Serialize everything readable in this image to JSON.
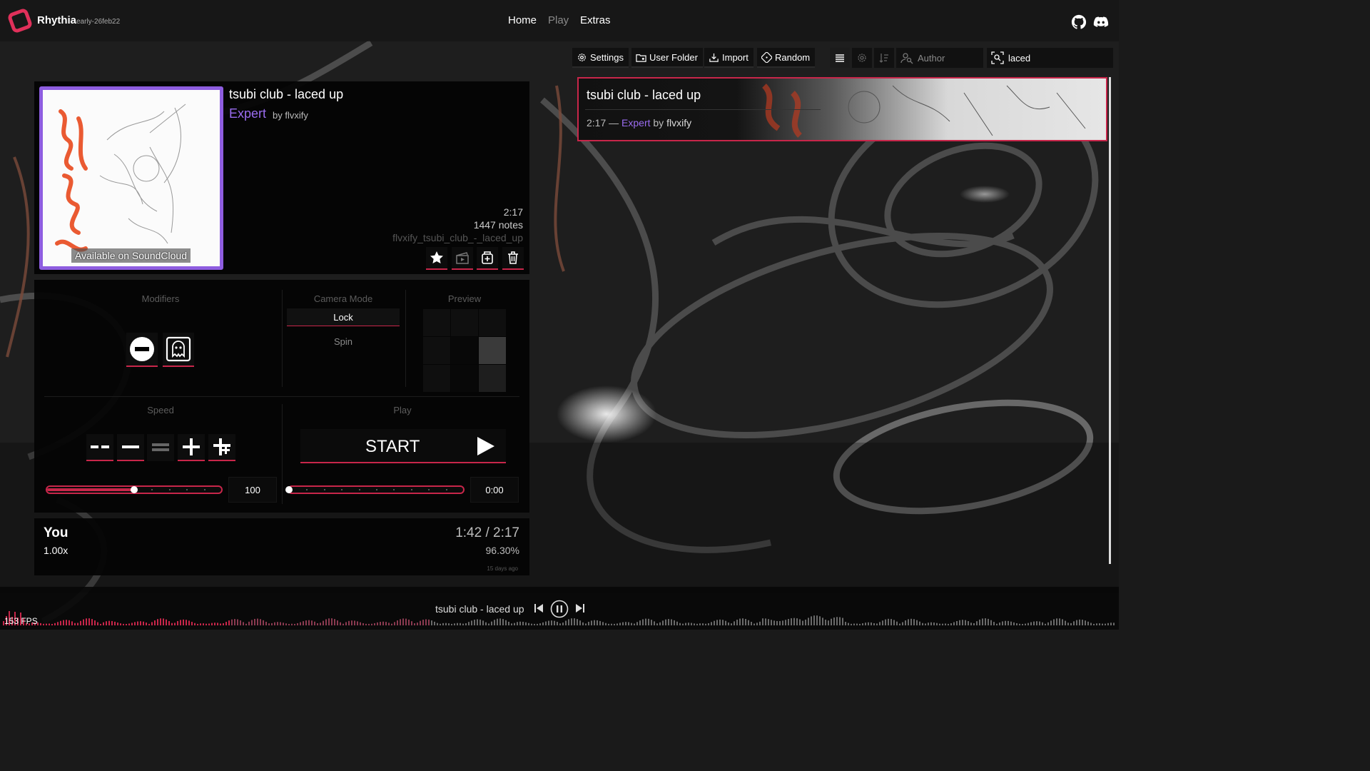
{
  "app": {
    "name": "Rhythia",
    "version": "early-26feb22",
    "accent_color": "#c8264a",
    "difficulty_color": "#9a6cf0"
  },
  "nav": {
    "items": [
      {
        "label": "Home",
        "active": true
      },
      {
        "label": "Play",
        "active": false
      },
      {
        "label": "Extras",
        "active": true
      }
    ],
    "right_icons": [
      "github-icon",
      "discord-icon"
    ]
  },
  "toolbar": {
    "settings_label": "Settings",
    "user_folder_label": "User Folder",
    "import_label": "Import",
    "random_label": "Random",
    "view_icons": [
      "list-view-icon",
      "filter-settings-icon",
      "sort-icon"
    ],
    "author_placeholder": "Author",
    "search_value": "laced"
  },
  "selected_map": {
    "title": "tsubi club - laced up",
    "difficulty": "Expert",
    "by_label": "by flvxify",
    "cover_badge": "Available on SoundCloud",
    "length": "2:17",
    "notes": "1447 notes",
    "map_id": "flvxify_tsubi_club_-_laced_up",
    "actions": [
      "favorite-star-icon",
      "video-icon",
      "copy-icon",
      "delete-icon"
    ]
  },
  "modifiers": {
    "label": "Modifiers",
    "buttons": [
      "no-fail-icon",
      "ghost-icon"
    ]
  },
  "camera": {
    "label": "Camera Mode",
    "options": [
      {
        "label": "Lock",
        "selected": true
      },
      {
        "label": "Spin",
        "selected": false
      }
    ]
  },
  "preview": {
    "label": "Preview"
  },
  "speed": {
    "label": "Speed",
    "buttons": [
      "speed-down-large-icon",
      "speed-down-icon",
      "speed-reset-icon",
      "speed-up-icon",
      "speed-up-large-icon"
    ],
    "slider_fraction": 0.5,
    "value": "100"
  },
  "play": {
    "label": "Play",
    "start_label": "START",
    "slider_fraction": 0.0,
    "start_time": "0:00"
  },
  "score": {
    "player": "You",
    "speed": "1.00x",
    "time": "1:42 / 2:17",
    "accuracy": "96.30%",
    "ago": "15 days ago"
  },
  "map_list": [
    {
      "title": "tsubi club - laced up",
      "length": "2:17",
      "separator": "—",
      "difficulty": "Expert",
      "by": "by",
      "author": "flvxify"
    }
  ],
  "now_playing": {
    "title": "tsubi club - laced up",
    "controls": [
      "previous-icon",
      "pause-icon",
      "next-icon"
    ],
    "fps": "153 FPS"
  }
}
